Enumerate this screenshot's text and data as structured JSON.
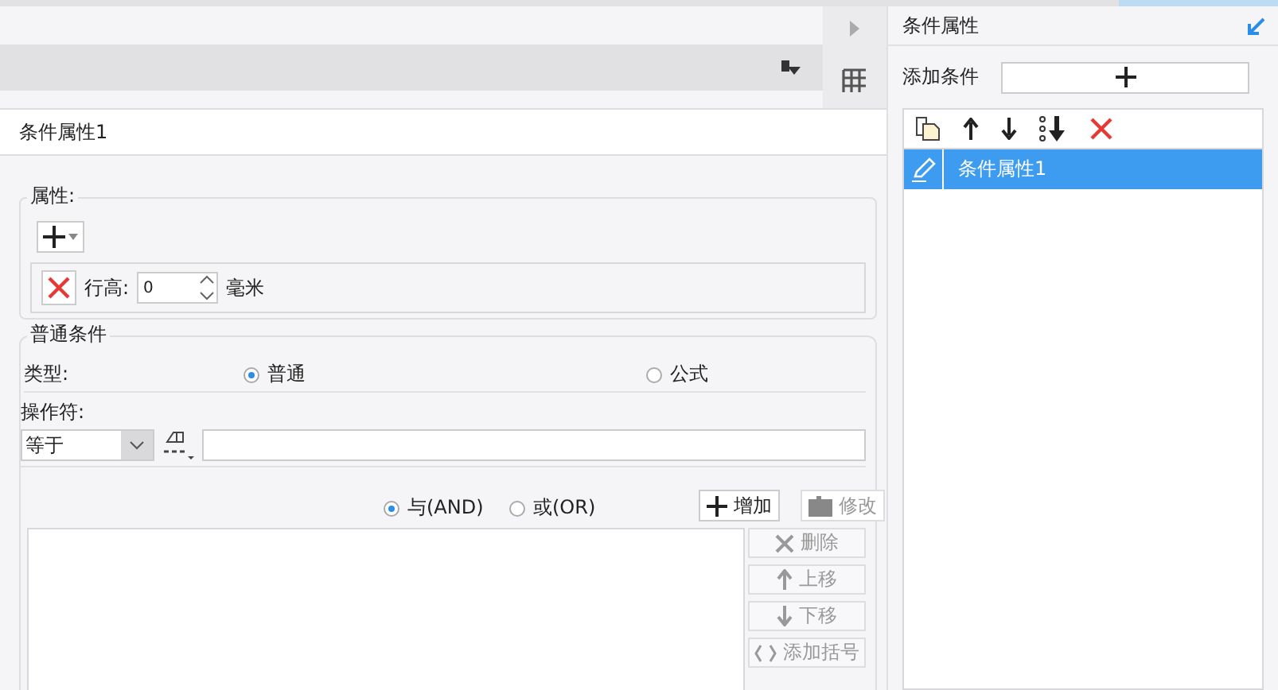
{
  "editor_title": "条件属性1",
  "attributes": {
    "legend": "属性:",
    "rows": [
      {
        "label": "行高:",
        "value": "0",
        "unit": "毫米"
      }
    ]
  },
  "condition": {
    "legend": "普通条件",
    "type_label": "类型:",
    "types": [
      {
        "label": "普通",
        "selected": true
      },
      {
        "label": "公式",
        "selected": false
      }
    ],
    "operator_label": "操作符:",
    "operator": "等于",
    "joins": [
      {
        "label": "与(AND)",
        "selected": true
      },
      {
        "label": "或(OR)",
        "selected": false
      }
    ],
    "actions": [
      {
        "label": "增加",
        "disabled": false
      },
      {
        "label": "修改",
        "disabled": true
      }
    ],
    "side_buttons": [
      {
        "label": "删除",
        "disabled": true
      },
      {
        "label": "上移",
        "disabled": true
      },
      {
        "label": "下移",
        "disabled": true
      },
      {
        "label": "添加括号",
        "disabled": true
      }
    ]
  },
  "panel": {
    "title": "条件属性",
    "add_label": "添加条件",
    "items": [
      {
        "label": "条件属性1",
        "selected": true
      }
    ]
  }
}
